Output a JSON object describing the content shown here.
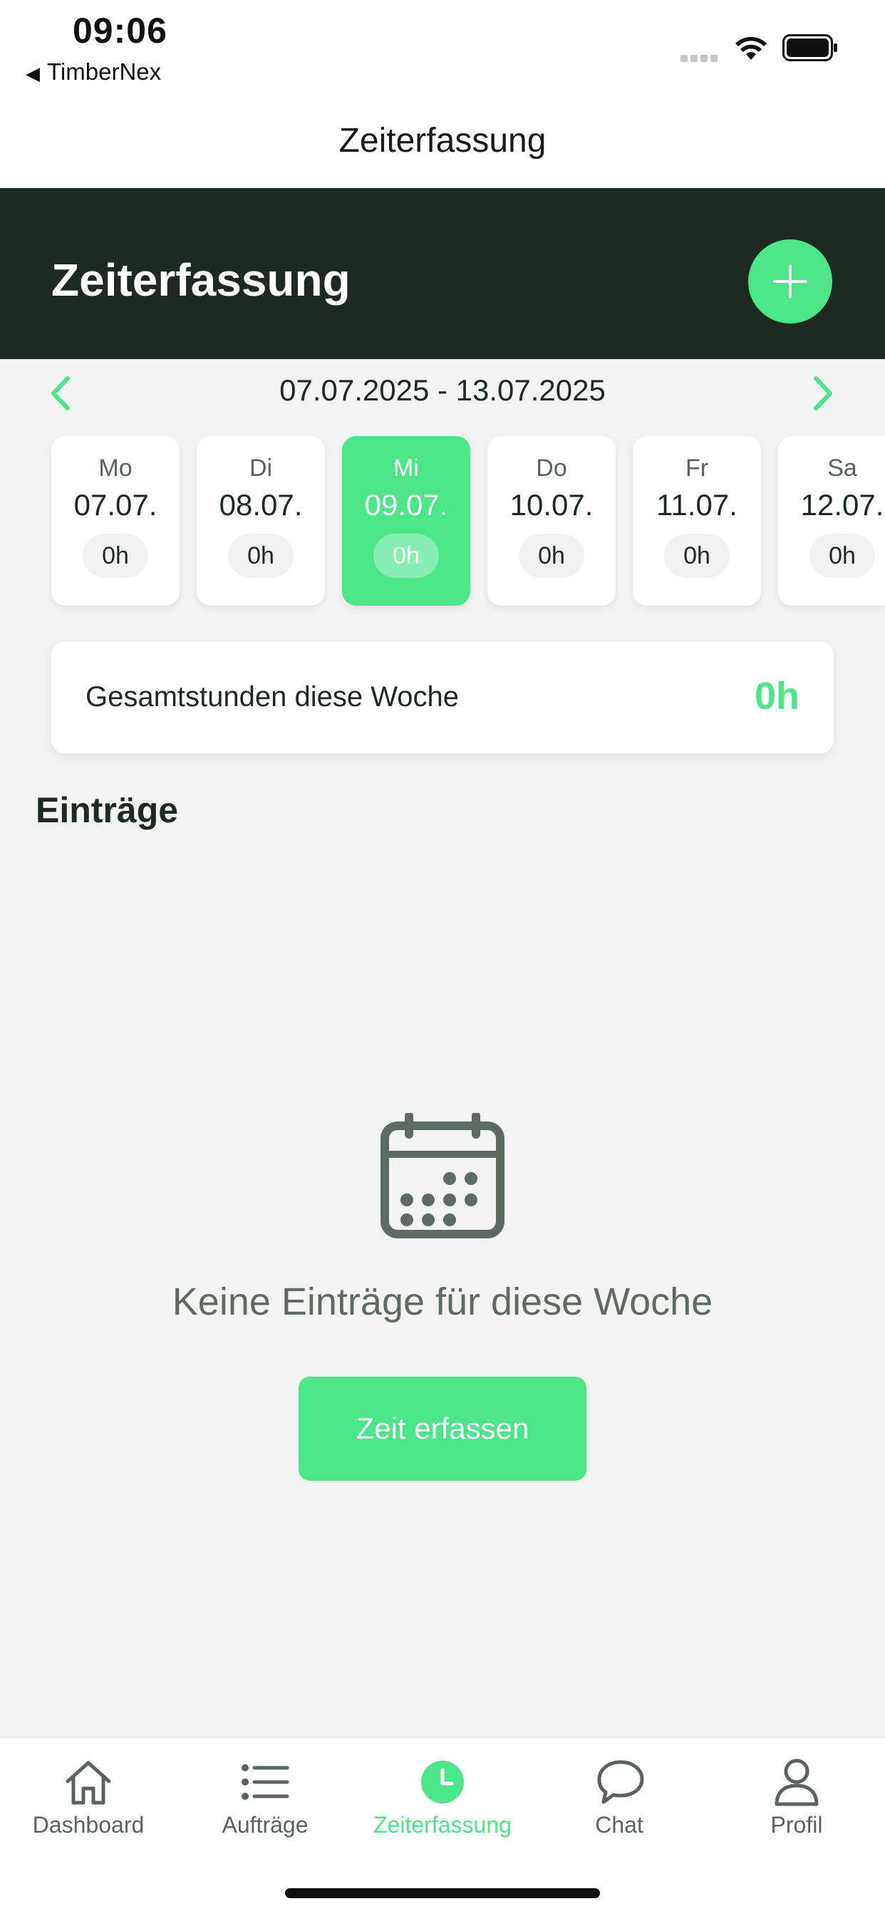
{
  "status_bar": {
    "time": "09:06",
    "back_app": "TimberNex"
  },
  "nav": {
    "title": "Zeiterfassung"
  },
  "header": {
    "title": "Zeiterfassung",
    "add_icon": "plus-icon"
  },
  "week": {
    "range": "07.07.2025 - 13.07.2025",
    "days": [
      {
        "name": "Mo",
        "date": "07.07.",
        "hours": "0h"
      },
      {
        "name": "Di",
        "date": "08.07.",
        "hours": "0h"
      },
      {
        "name": "Mi",
        "date": "09.07.",
        "hours": "0h"
      },
      {
        "name": "Do",
        "date": "10.07.",
        "hours": "0h"
      },
      {
        "name": "Fr",
        "date": "11.07.",
        "hours": "0h"
      },
      {
        "name": "Sa",
        "date": "12.07.",
        "hours": "0h"
      }
    ],
    "selected_index": 2
  },
  "total": {
    "label": "Gesamtstunden diese Woche",
    "value": "0h"
  },
  "entries": {
    "title": "Einträge",
    "empty_text": "Keine Einträge für diese Woche",
    "cta": "Zeit erfassen"
  },
  "tabs": [
    {
      "label": "Dashboard",
      "icon": "home-icon"
    },
    {
      "label": "Aufträge",
      "icon": "list-icon"
    },
    {
      "label": "Zeiterfassung",
      "icon": "clock-icon"
    },
    {
      "label": "Chat",
      "icon": "chat-icon"
    },
    {
      "label": "Profil",
      "icon": "profile-icon"
    }
  ],
  "colors": {
    "accent": "#4ae688",
    "header_bg": "#1c2a21",
    "background": "#f3f3f3"
  }
}
